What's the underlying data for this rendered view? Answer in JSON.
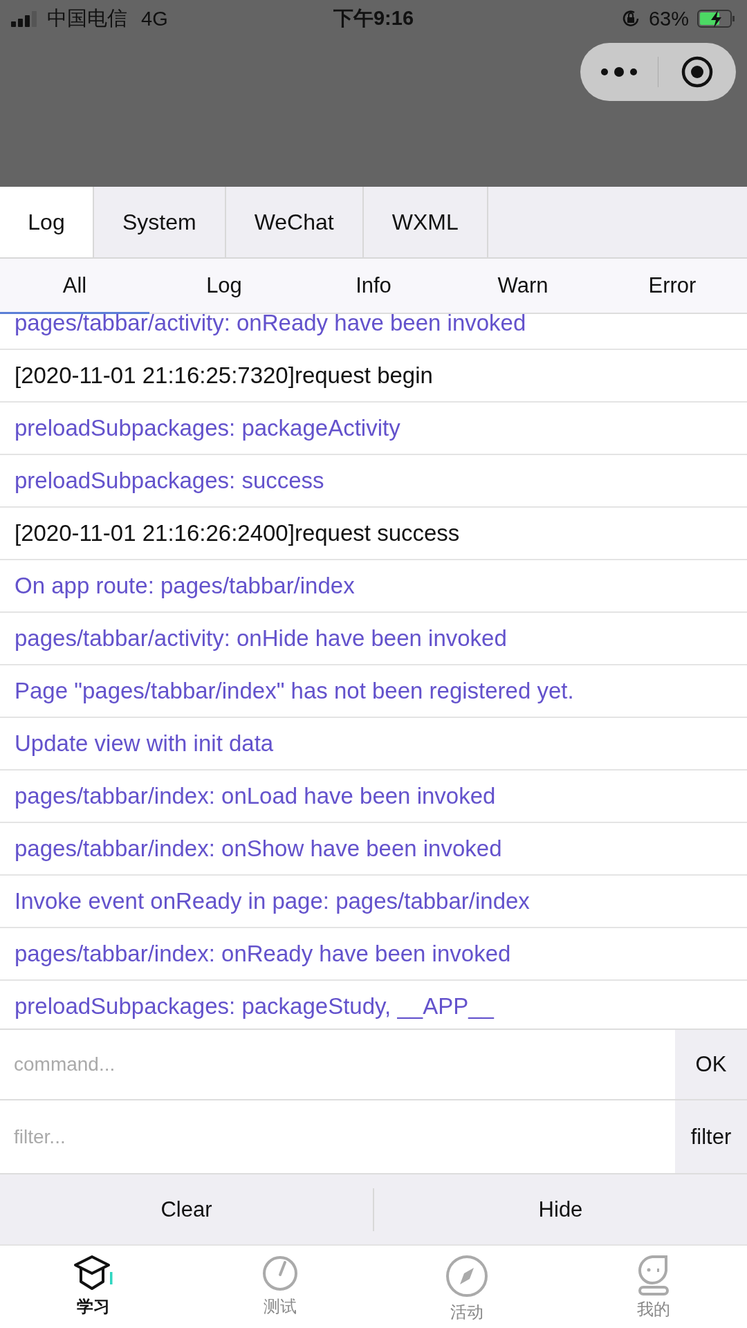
{
  "status_bar": {
    "carrier": "中国电信",
    "network": "4G",
    "time": "下午9:16",
    "battery": "63%"
  },
  "tabs": [
    {
      "label": "Log",
      "selected": true
    },
    {
      "label": "System",
      "selected": false
    },
    {
      "label": "WeChat",
      "selected": false
    },
    {
      "label": "WXML",
      "selected": false
    }
  ],
  "filters": [
    {
      "label": "All",
      "selected": true
    },
    {
      "label": "Log",
      "selected": false
    },
    {
      "label": "Info",
      "selected": false
    },
    {
      "label": "Warn",
      "selected": false
    },
    {
      "label": "Error",
      "selected": false
    }
  ],
  "logs": [
    {
      "kind": "info",
      "text": "pages/tabbar/activity: onReady have been invoked"
    },
    {
      "kind": "log",
      "text": "[2020-11-01 21:16:25:7320]request begin"
    },
    {
      "kind": "info",
      "text": "preloadSubpackages: packageActivity"
    },
    {
      "kind": "info",
      "text": "preloadSubpackages: success"
    },
    {
      "kind": "log",
      "text": "[2020-11-01 21:16:26:2400]request success"
    },
    {
      "kind": "info",
      "text": "On app route: pages/tabbar/index"
    },
    {
      "kind": "info",
      "text": "pages/tabbar/activity: onHide have been invoked"
    },
    {
      "kind": "info",
      "text": "Page \"pages/tabbar/index\" has not been registered yet."
    },
    {
      "kind": "info",
      "text": "Update view with init data"
    },
    {
      "kind": "info",
      "text": "pages/tabbar/index: onLoad have been invoked"
    },
    {
      "kind": "info",
      "text": "pages/tabbar/index: onShow have been invoked"
    },
    {
      "kind": "info",
      "text": "Invoke event onReady in page: pages/tabbar/index"
    },
    {
      "kind": "info",
      "text": "pages/tabbar/index: onReady have been invoked"
    },
    {
      "kind": "info",
      "text": "preloadSubpackages: packageStudy, __APP__"
    }
  ],
  "command": {
    "placeholder": "command...",
    "button": "OK"
  },
  "filter": {
    "placeholder": "filter...",
    "button": "filter"
  },
  "actions": [
    "Clear",
    "Hide"
  ],
  "nav": [
    {
      "kind": "study",
      "label": "学习",
      "selected": true
    },
    {
      "kind": "test",
      "label": "测试",
      "selected": false
    },
    {
      "kind": "activity",
      "label": "活动",
      "selected": false
    },
    {
      "kind": "profile",
      "label": "我的",
      "selected": false
    }
  ]
}
